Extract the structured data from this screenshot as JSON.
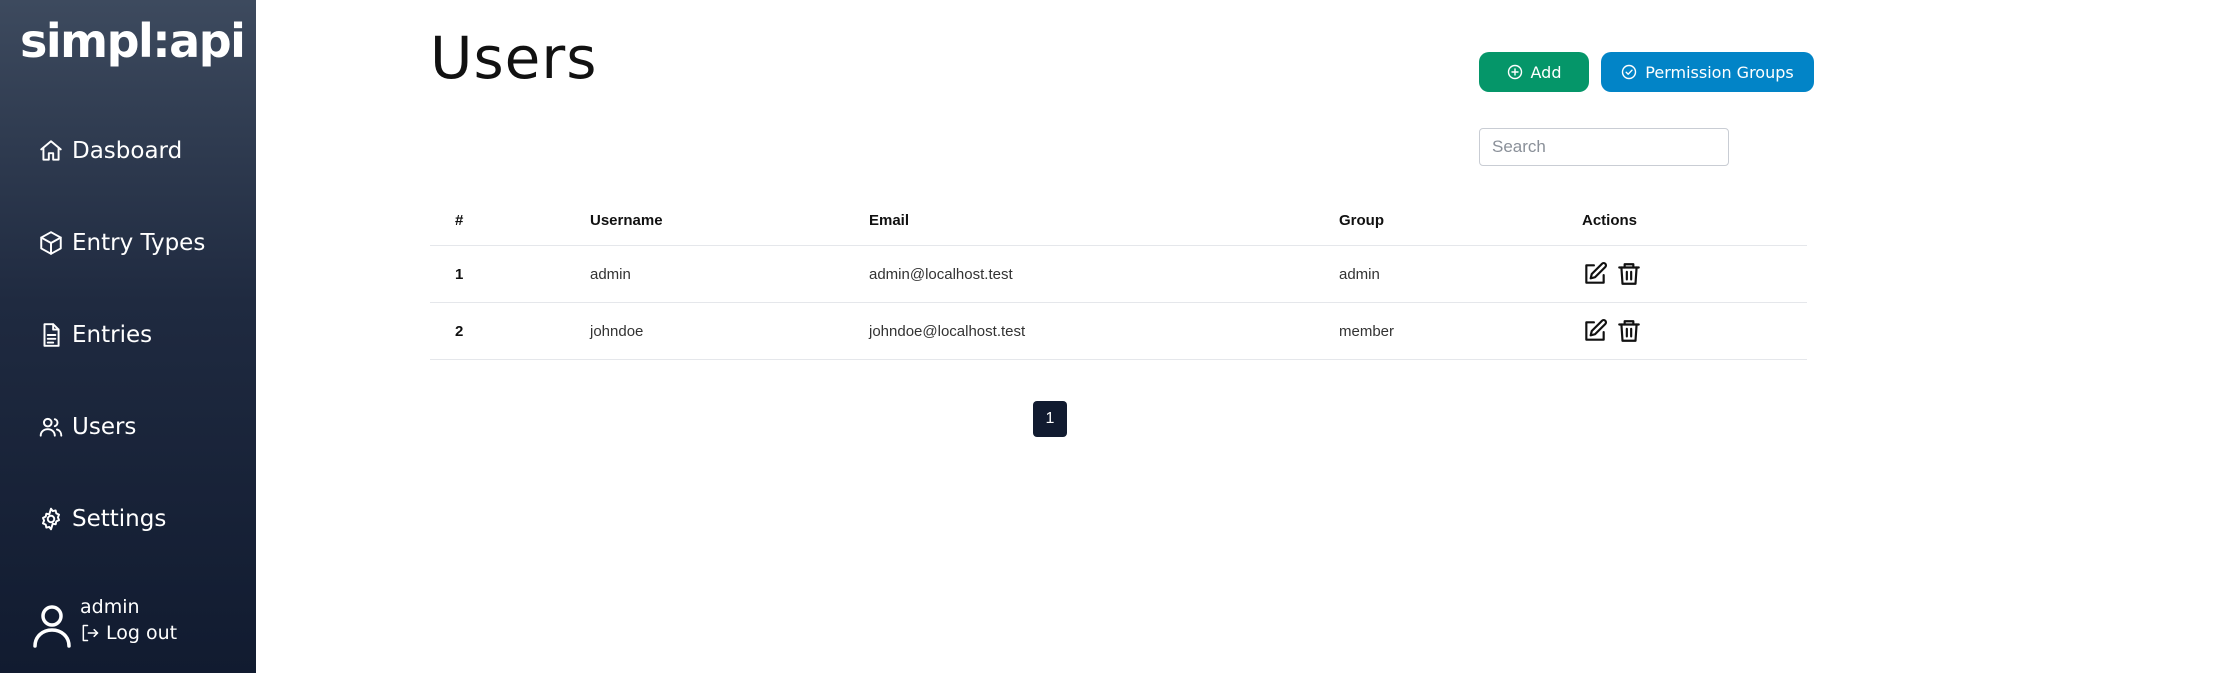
{
  "app": {
    "logo_text": "simpl:api"
  },
  "sidebar": {
    "items": [
      {
        "label": "Dasboard",
        "icon": "home-icon"
      },
      {
        "label": "Entry Types",
        "icon": "cube-icon"
      },
      {
        "label": "Entries",
        "icon": "document-icon"
      },
      {
        "label": "Users",
        "icon": "users-icon"
      },
      {
        "label": "Settings",
        "icon": "gear-icon"
      }
    ],
    "user": {
      "name": "admin",
      "logout_label": "Log out"
    }
  },
  "main": {
    "title": "Users",
    "add_label": "Add",
    "permission_groups_label": "Permission Groups",
    "search_placeholder": "Search",
    "table": {
      "headers": {
        "num": "#",
        "username": "Username",
        "email": "Email",
        "group": "Group",
        "actions": "Actions"
      },
      "rows": [
        {
          "num": "1",
          "username": "admin",
          "email": "admin@localhost.test",
          "group": "admin"
        },
        {
          "num": "2",
          "username": "johndoe",
          "email": "johndoe@localhost.test",
          "group": "member"
        }
      ]
    },
    "pagination": {
      "current_page": "1"
    }
  },
  "colors": {
    "add_button": "#059669",
    "permission_button": "#0284c7",
    "sidebar_dark": "#111b30"
  }
}
